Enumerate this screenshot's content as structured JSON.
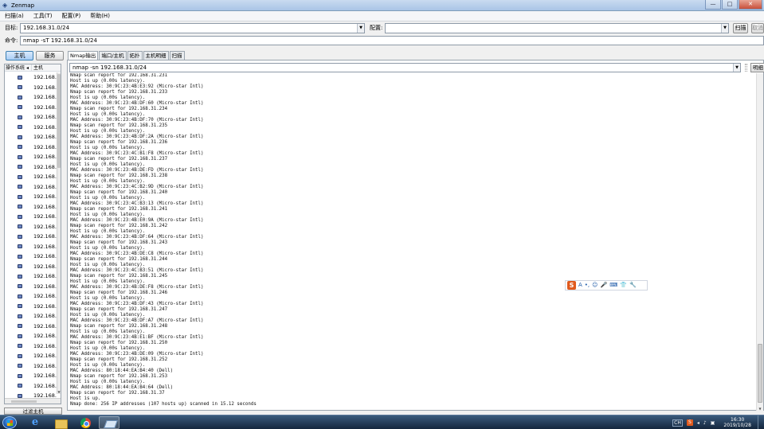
{
  "window": {
    "title": "Zenmap"
  },
  "window_buttons": [
    "—",
    "□",
    "✕"
  ],
  "menu": [
    "扫描(a)",
    "工具(T)",
    "配置(P)",
    "帮助(H)"
  ],
  "toolbar": {
    "target_label": "目标:",
    "target_value": "192.168.31.0/24",
    "profile_label": "配置:",
    "profile_value": "",
    "scan_button": "扫描",
    "cancel_button": "取消"
  },
  "command": {
    "label": "命令:",
    "value": "nmap -sT 192.168.31.0/24"
  },
  "left_panel": {
    "tabs": [
      "主机",
      "服务"
    ],
    "active_tab": 0,
    "col_os": "操作系统",
    "col_host": "主机",
    "sort_indicator": "◂",
    "hosts": [
      "192.168.",
      "192.168.",
      "192.168.",
      "192.168.",
      "192.168.",
      "192.168.",
      "192.168.",
      "192.168.",
      "192.168.",
      "192.168.",
      "192.168.",
      "192.168.",
      "192.168.",
      "192.168.",
      "192.168.",
      "192.168.",
      "192.168.",
      "192.168.",
      "192.168.",
      "192.168.",
      "192.168.",
      "192.168.",
      "192.168.",
      "192.168.",
      "192.168.",
      "192.168.",
      "192.168.",
      "192.168.",
      "192.168.",
      "192.168.",
      "192.168.",
      "192.168.",
      "192.168."
    ],
    "filter_button": "过滤主机"
  },
  "result_tabs": [
    "Nmap输出",
    "端口/主机",
    "拓扑",
    "主机明细",
    "扫描"
  ],
  "active_result_tab": 0,
  "output": {
    "selected_command": "nmap -sn 192.168.31.0/24",
    "details_button": "明细",
    "lines": [
      "Nmap scan report for 192.168.31.231",
      "Host is up (0.00s latency).",
      "MAC Address: 30:9C:23:4B:E3:92 (Micro-star Intl)",
      "Nmap scan report for 192.168.31.233",
      "Host is up (0.00s latency).",
      "MAC Address: 30:9C:23:4B:DF:60 (Micro-star Intl)",
      "Nmap scan report for 192.168.31.234",
      "Host is up (0.00s latency).",
      "MAC Address: 30:9C:23:4B:DF:70 (Micro-star Intl)",
      "Nmap scan report for 192.168.31.235",
      "Host is up (0.00s latency).",
      "MAC Address: 30:9C:23:4B:DF:2A (Micro-star Intl)",
      "Nmap scan report for 192.168.31.236",
      "Host is up (0.00s latency).",
      "MAC Address: 30:9C:23:4C:B1:F8 (Micro-star Intl)",
      "Nmap scan report for 192.168.31.237",
      "Host is up (0.00s latency).",
      "MAC Address: 30:9C:23:4B:DE:FD (Micro-star Intl)",
      "Nmap scan report for 192.168.31.238",
      "Host is up (0.00s latency).",
      "MAC Address: 30:9C:23:4C:B2:9D (Micro-star Intl)",
      "Nmap scan report for 192.168.31.240",
      "Host is up (0.00s latency).",
      "MAC Address: 30:9C:23:4C:B3:13 (Micro-star Intl)",
      "Nmap scan report for 192.168.31.241",
      "Host is up (0.00s latency).",
      "MAC Address: 30:9C:23:4B:E0:9A (Micro-star Intl)",
      "Nmap scan report for 192.168.31.242",
      "Host is up (0.00s latency).",
      "MAC Address: 30:9C:23:4B:DF:64 (Micro-star Intl)",
      "Nmap scan report for 192.168.31.243",
      "Host is up (0.00s latency).",
      "MAC Address: 30:9C:23:4B:DE:C8 (Micro-star Intl)",
      "Nmap scan report for 192.168.31.244",
      "Host is up (0.00s latency).",
      "MAC Address: 30:9C:23:4C:B3:51 (Micro-star Intl)",
      "Nmap scan report for 192.168.31.245",
      "Host is up (0.00s latency).",
      "MAC Address: 30:9C:23:4B:DE:F8 (Micro-star Intl)",
      "Nmap scan report for 192.168.31.246",
      "Host is up (0.00s latency).",
      "MAC Address: 30:9C:23:4B:DF:43 (Micro-star Intl)",
      "Nmap scan report for 192.168.31.247",
      "Host is up (0.00s latency).",
      "MAC Address: 30:9C:23:4B:DF:A7 (Micro-star Intl)",
      "Nmap scan report for 192.168.31.248",
      "Host is up (0.00s latency).",
      "MAC Address: 30:9C:23:4B:E1:BF (Micro-star Intl)",
      "Nmap scan report for 192.168.31.250",
      "Host is up (0.00s latency).",
      "MAC Address: 30:9C:23:4B:DE:09 (Micro-star Intl)",
      "Nmap scan report for 192.168.31.252",
      "Host is up (0.00s latency).",
      "MAC Address: 80:18:44:EA:B4:40 (Dell)",
      "Nmap scan report for 192.168.31.253",
      "Host is up (0.00s latency).",
      "MAC Address: 80:18:44:EA:B4:64 (Dell)",
      "Nmap scan report for 192.168.31.37",
      "Host is up.",
      "Nmap done: 256 IP addresses (107 hosts up) scanned in 15.12 seconds"
    ]
  },
  "ime_toolbar": {
    "logo": "S",
    "items": [
      "A",
      "•,",
      "☺",
      "🎤",
      "⌨",
      "👕",
      "🔧"
    ]
  },
  "taskbar": {
    "lang": "CH",
    "sogou": "S",
    "tray_icons": [
      "◂",
      "♪",
      "▣"
    ],
    "time": "16:30",
    "date": "2019/10/28"
  }
}
